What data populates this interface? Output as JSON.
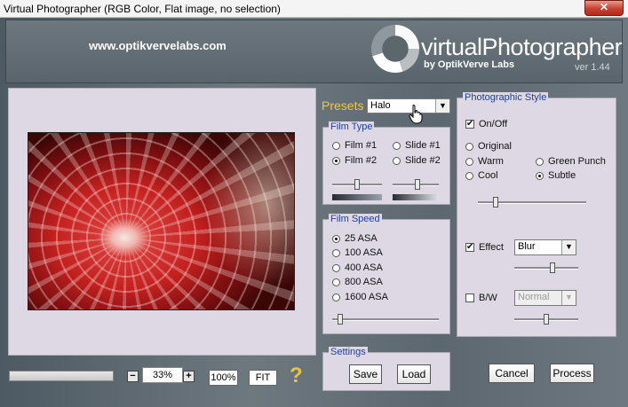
{
  "window": {
    "title": "Virtual Photographer (RGB Color, Flat image, no selection)",
    "close_glyph": "✕"
  },
  "header": {
    "website": "www.optikvervelabs.com",
    "logo_text": "virtualPhotographer",
    "by_text": "by OptikVerve Labs",
    "version": "ver 1.44"
  },
  "zoom": {
    "minus": "−",
    "plus": "+",
    "value": "33%",
    "btn_100": "100%",
    "btn_fit": "FIT",
    "help": "?"
  },
  "presets": {
    "label": "Presets",
    "selected": "Halo"
  },
  "film_type": {
    "title": "Film Type",
    "options": [
      "Film #1",
      "Slide #1",
      "Film #2",
      "Slide #2"
    ],
    "selected": "Film #2",
    "film_slider": 0.5,
    "slide_slider": 0.55
  },
  "film_speed": {
    "title": "Film Speed",
    "options": [
      "25 ASA",
      "100 ASA",
      "400 ASA",
      "800 ASA",
      "1600 ASA"
    ],
    "selected": "25 ASA",
    "slider": 0.05
  },
  "settings": {
    "title": "Settings",
    "save": "Save",
    "load": "Load"
  },
  "style": {
    "title": "Photographic Style",
    "onoff": "On/Off",
    "onoff_checked": true,
    "options": [
      "Original",
      "Warm",
      "Green Punch",
      "Cool",
      "Subtle"
    ],
    "selected": "Subtle",
    "slider": 0.15,
    "effect_label": "Effect",
    "effect_checked": true,
    "effect_value": "Blur",
    "effect_slider": 0.6,
    "bw_label": "B/W",
    "bw_checked": false,
    "bw_value": "Normal",
    "bw_slider": 0.5
  },
  "actions": {
    "cancel": "Cancel",
    "process": "Process"
  },
  "progress": 0,
  "colors": {
    "accent_label": "#f1c741",
    "group_title": "#1f3f9d",
    "panel_bg": "#ddd8e4"
  }
}
